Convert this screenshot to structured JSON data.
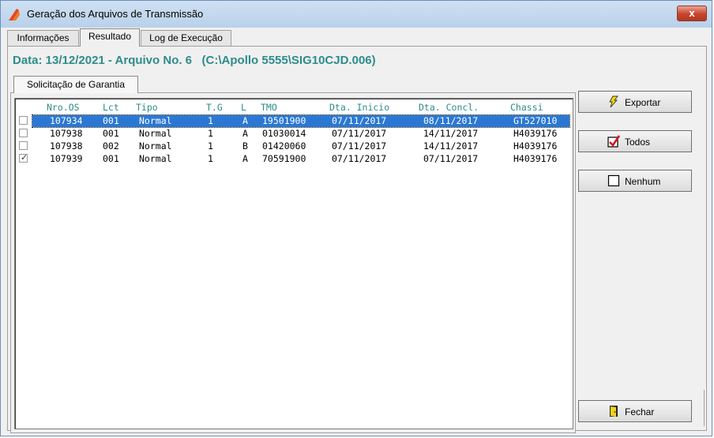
{
  "window": {
    "title": "Geração dos Arquivos de Transmissão",
    "close_label": "x"
  },
  "tabs": [
    {
      "label": "Informações"
    },
    {
      "label": "Resultado"
    },
    {
      "label": "Log de Execução"
    }
  ],
  "header": {
    "data_text": "Data: 13/12/2021 - Arquivo No. 6",
    "path_text": "(C:\\Apollo 5555\\SIG10CJD.006)"
  },
  "inner_tab": {
    "label": "Solicitação de Garantia"
  },
  "grid": {
    "columns": [
      "Nro.OS",
      "Lct",
      "Tipo",
      "T.G",
      "L",
      "TMO",
      "Dta. Inicio",
      "Dta. Concl.",
      "Chassi"
    ],
    "rows": [
      {
        "checked": false,
        "selected": true,
        "nro_os": "107934",
        "lct": "001",
        "tipo": "Normal",
        "tg": "1",
        "l": "A",
        "tmo": "19501900",
        "dta_inicio": "07/11/2017",
        "dta_concl": "08/11/2017",
        "chassi": "GT527010"
      },
      {
        "checked": false,
        "selected": false,
        "nro_os": "107938",
        "lct": "001",
        "tipo": "Normal",
        "tg": "1",
        "l": "A",
        "tmo": "01030014",
        "dta_inicio": "07/11/2017",
        "dta_concl": "14/11/2017",
        "chassi": "H4039176"
      },
      {
        "checked": false,
        "selected": false,
        "nro_os": "107938",
        "lct": "002",
        "tipo": "Normal",
        "tg": "1",
        "l": "B",
        "tmo": "01420060",
        "dta_inicio": "07/11/2017",
        "dta_concl": "14/11/2017",
        "chassi": "H4039176"
      },
      {
        "checked": true,
        "selected": false,
        "nro_os": "107939",
        "lct": "001",
        "tipo": "Normal",
        "tg": "1",
        "l": "A",
        "tmo": "70591900",
        "dta_inicio": "07/11/2017",
        "dta_concl": "07/11/2017",
        "chassi": "H4039176"
      }
    ]
  },
  "buttons": {
    "exportar": {
      "label": "Exportar",
      "icon": "lightning-icon"
    },
    "todos": {
      "label": "Todos",
      "icon": "checked-box-icon"
    },
    "nenhum": {
      "label": "Nenhum",
      "icon": "empty-box-icon"
    },
    "fechar": {
      "label": "Fechar",
      "icon": "door-icon"
    }
  },
  "colors": {
    "accent": "#2e8b8b",
    "selection": "#2b78d4"
  }
}
